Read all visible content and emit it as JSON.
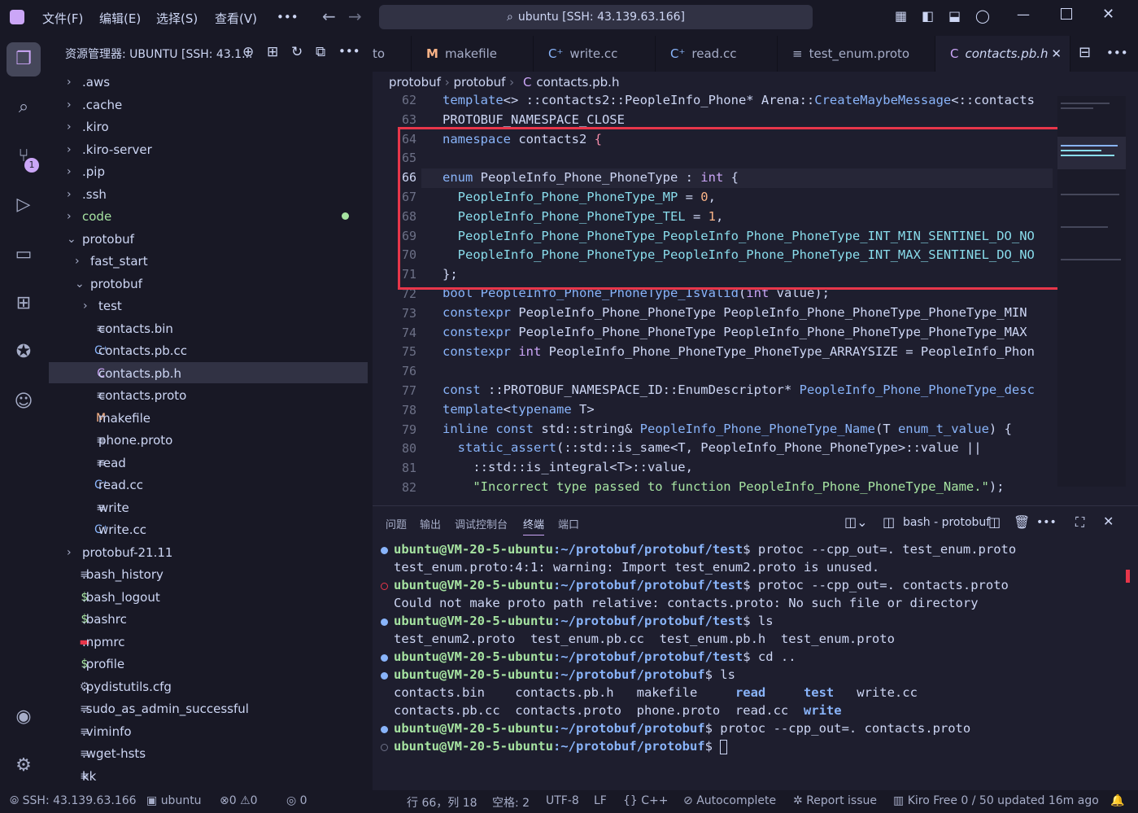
{
  "titlebar": {
    "menus": [
      "文件(F)",
      "编辑(E)",
      "选择(S)",
      "查看(V)",
      "•••"
    ],
    "search": "ubuntu [SSH: 43.139.63.166]"
  },
  "activity": {
    "scm_badge": "1"
  },
  "sidebar": {
    "title": "资源管理器: UBUNTU [SSH: 43.1...",
    "items": [
      ".aws",
      ".cache",
      ".kiro",
      ".kiro-server",
      ".pip",
      ".ssh",
      "code",
      "protobuf",
      "fast_start",
      "protobuf",
      "test",
      "contacts.bin",
      "contacts.pb.cc",
      "contacts.pb.h",
      "contacts.proto",
      "makefile",
      "phone.proto",
      "read",
      "read.cc",
      "write",
      "write.cc",
      "protobuf-21.11",
      ".bash_history",
      ".bash_logout",
      ".bashrc",
      ".npmrc",
      ".profile",
      ".pydistutils.cfg",
      ".sudo_as_admin_successful",
      ".viminfo",
      ".wget-hsts",
      "kk"
    ]
  },
  "tabs": [
    "to",
    "makefile",
    "write.cc",
    "read.cc",
    "test_enum.proto",
    "contacts.pb.h"
  ],
  "breadcrumb": [
    "protobuf",
    "protobuf",
    "contacts.pb.h"
  ],
  "editor": {
    "line_numbers": [
      "62",
      "63",
      "64",
      "65",
      "66",
      "67",
      "68",
      "69",
      "70",
      "71",
      "72",
      "73",
      "74",
      "75",
      "76",
      "77",
      "78",
      "79",
      "80",
      "81",
      "82"
    ]
  },
  "panel": {
    "tabs": [
      "问题",
      "输出",
      "调试控制台",
      "终端",
      "端口"
    ],
    "shell": "bash - protobuf",
    "lines": [
      {
        "prompt": "ubuntu@VM-20-5-ubuntu",
        "path": ":~/protobuf/protobuf/test",
        "cmd": "$ protoc --cpp_out=. test_enum.proto"
      },
      {
        "text": "test_enum.proto:4:1: warning: Import test_enum2.proto is unused."
      },
      {
        "prompt": "ubuntu@VM-20-5-ubuntu",
        "path": ":~/protobuf/protobuf/test",
        "cmd": "$ protoc --cpp_out=. contacts.proto"
      },
      {
        "text": "Could not make proto path relative: contacts.proto: No such file or directory"
      },
      {
        "prompt": "ubuntu@VM-20-5-ubuntu",
        "path": ":~/protobuf/protobuf/test",
        "cmd": "$ ls"
      },
      {
        "text": "test_enum2.proto  test_enum.pb.cc  test_enum.pb.h  test_enum.proto"
      },
      {
        "prompt": "ubuntu@VM-20-5-ubuntu",
        "path": ":~/protobuf/protobuf/test",
        "cmd": "$ cd .."
      },
      {
        "prompt": "ubuntu@VM-20-5-ubuntu",
        "path": ":~/protobuf/protobuf",
        "cmd": "$ ls"
      },
      {
        "text": "contacts.bin    contacts.pb.h   makefile     read     test   write.cc"
      },
      {
        "text": "contacts.pb.cc  contacts.proto  phone.proto  read.cc  write"
      },
      {
        "prompt": "ubuntu@VM-20-5-ubuntu",
        "path": ":~/protobuf/protobuf",
        "cmd": "$ protoc --cpp_out=. contacts.proto"
      },
      {
        "prompt": "ubuntu@VM-20-5-ubuntu",
        "path": ":~/protobuf/protobuf",
        "cmd": "$ "
      }
    ]
  },
  "status": {
    "ssh": "SSH: 43.139.63.166",
    "host": "ubuntu",
    "errors": "0",
    "warnings": "0",
    "ports": "0",
    "position": "行 66，列 18",
    "spaces": "空格: 2",
    "encoding": "UTF-8",
    "eol": "LF",
    "lang": "{} C++",
    "autocomplete": "Autocomplete",
    "report": "Report issue",
    "kiro": "Kiro Free 0 / 50 updated 16m ago"
  },
  "colors": {
    "accent": "#cba6f7",
    "highlight_box": "#e8364a",
    "prompt": "#a6e3a1",
    "path": "#89b4fa"
  }
}
